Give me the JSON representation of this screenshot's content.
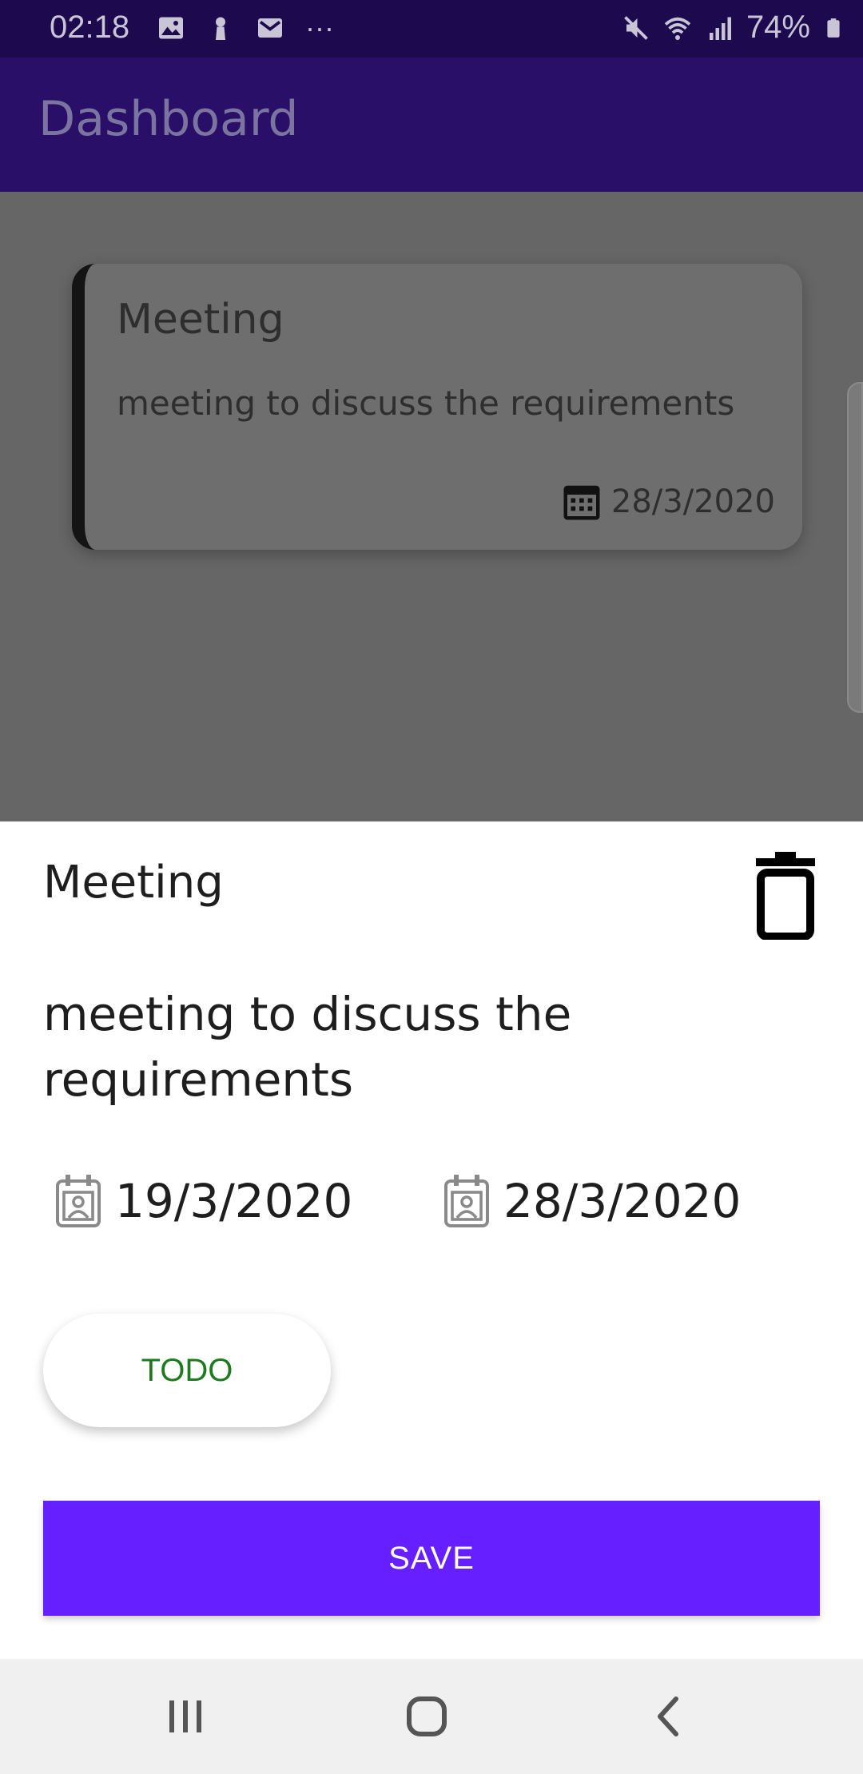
{
  "status_bar": {
    "time": "02:18",
    "battery": "74%",
    "left_icons": [
      "gallery-icon",
      "keyhole-icon",
      "mail-icon",
      "more-dots-icon"
    ],
    "right_icons": [
      "mute-icon",
      "wifi-icon",
      "signal-icon",
      "battery-icon"
    ],
    "more": "···"
  },
  "app_bar": {
    "title": "Dashboard"
  },
  "background_card": {
    "title": "Meeting",
    "description": "meeting to discuss the requirements",
    "due_date": "28/3/2020"
  },
  "sheet": {
    "title": "Meeting",
    "description": "meeting to discuss the requirements",
    "start_date": "19/3/2020",
    "end_date": "28/3/2020",
    "status_label": "TODO",
    "save_label": "SAVE"
  },
  "colors": {
    "status_bar": "#1d0a4e",
    "app_bar": "#2a0f68",
    "save_button": "#6620ff",
    "status_text": "#1f7a1f"
  }
}
